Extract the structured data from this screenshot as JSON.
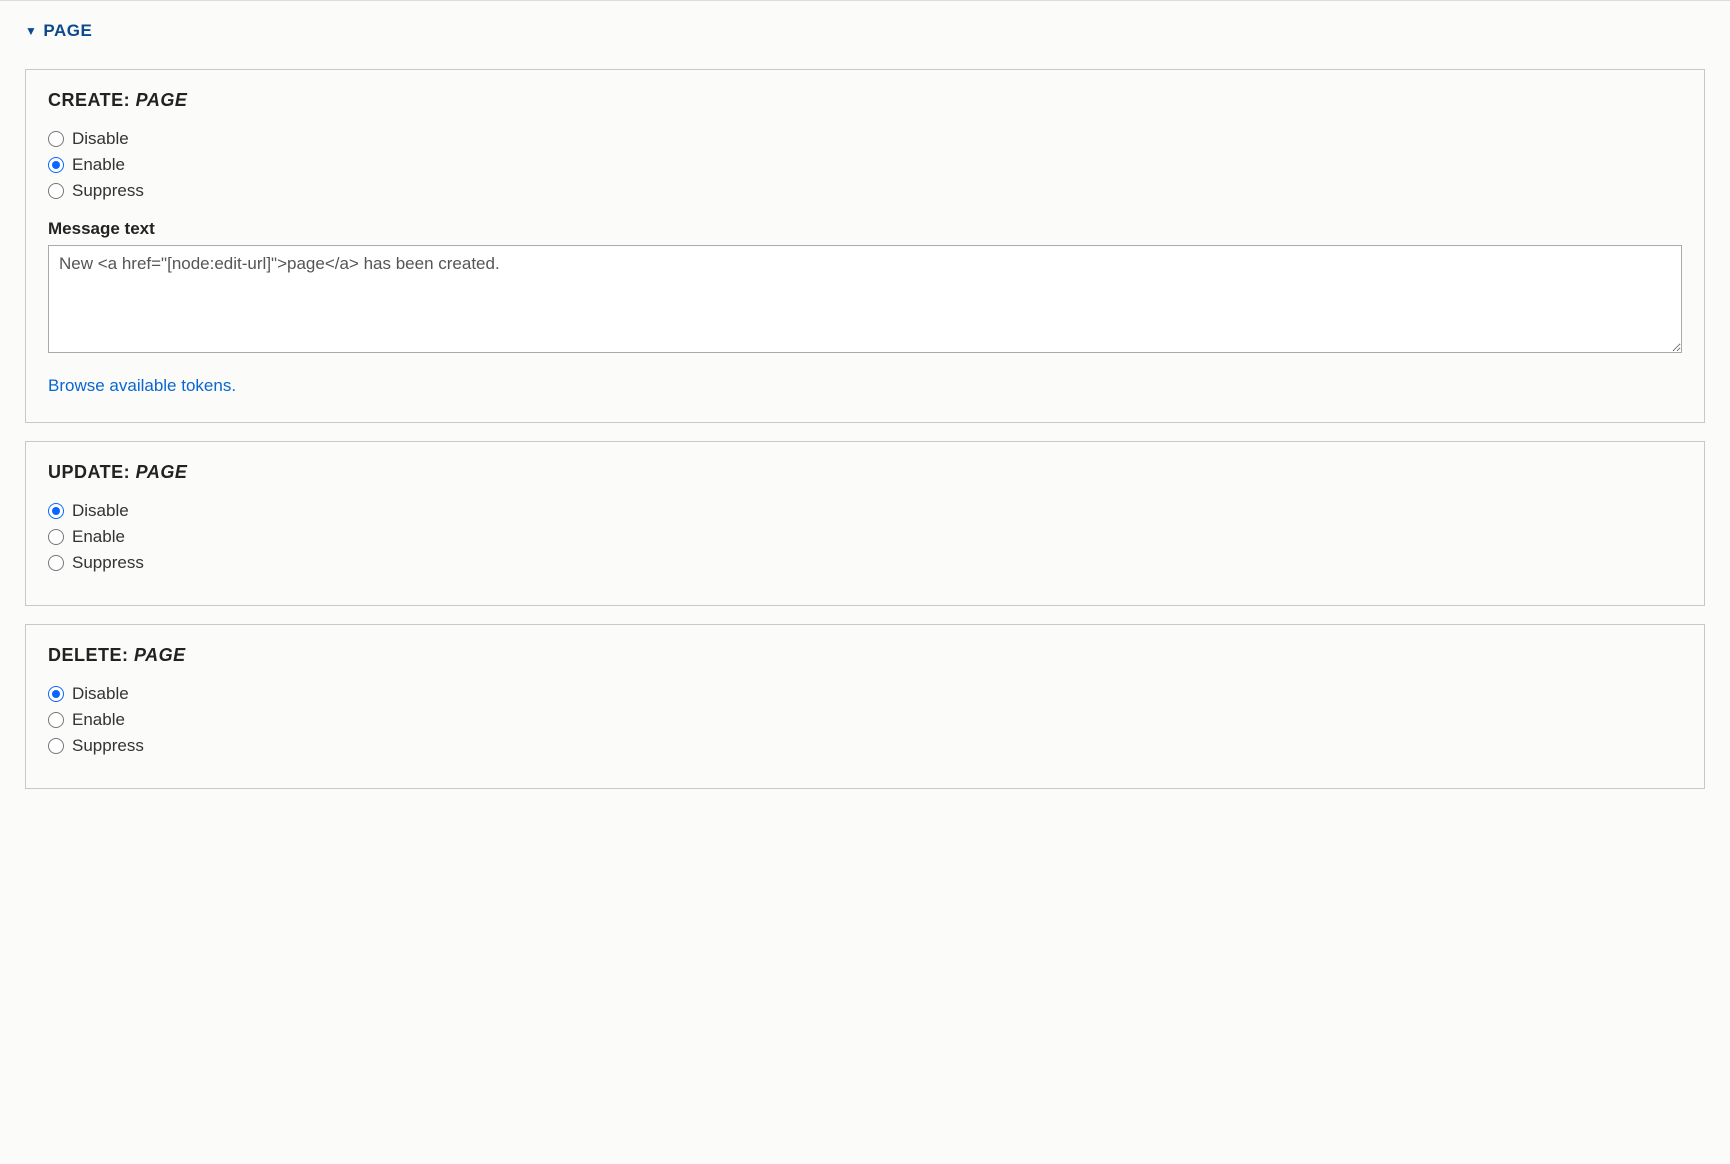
{
  "section": {
    "title": "PAGE"
  },
  "common": {
    "options": {
      "disable": "Disable",
      "enable": "Enable",
      "suppress": "Suppress"
    },
    "message_text_label": "Message text",
    "tokens_link": "Browse available tokens."
  },
  "panels": {
    "create": {
      "legend_prefix": "CREATE: ",
      "legend_entity": "PAGE",
      "selected": "enable",
      "message_text": "New <a href=\"[node:edit-url]\">page</a> has been created."
    },
    "update": {
      "legend_prefix": "UPDATE: ",
      "legend_entity": "PAGE",
      "selected": "disable"
    },
    "delete": {
      "legend_prefix": "DELETE: ",
      "legend_entity": "PAGE",
      "selected": "disable"
    }
  }
}
